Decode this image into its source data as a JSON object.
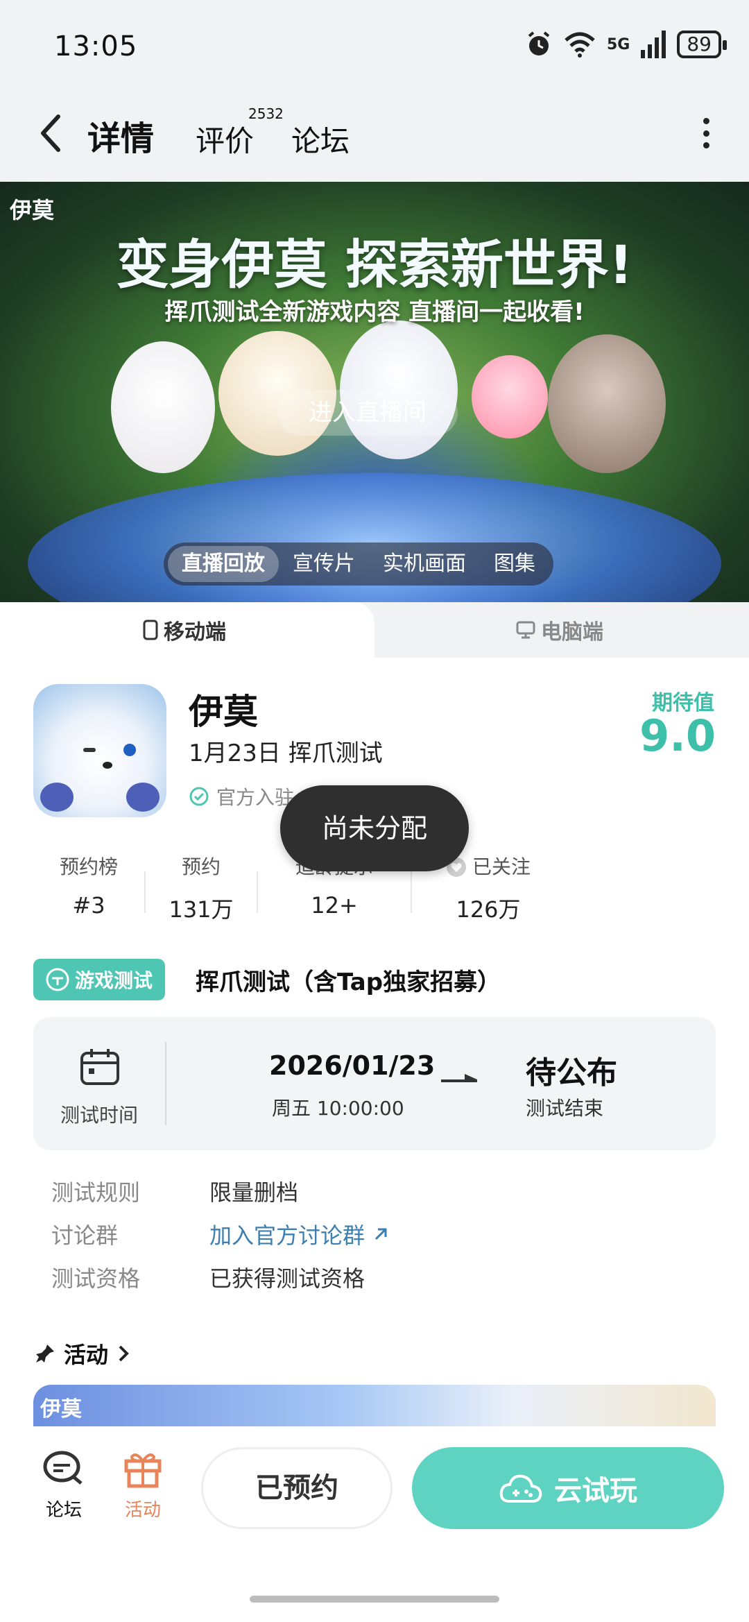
{
  "status_bar": {
    "time": "13:05",
    "battery": "89",
    "network": "5G"
  },
  "nav": {
    "tab_detail": "详情",
    "tab_review": "评价",
    "review_count": "2532",
    "tab_forum": "论坛"
  },
  "banner": {
    "logo": "伊莫",
    "title": "变身伊莫 探索新世界!",
    "subtitle": "挥爪测试全新游戏内容 直播间一起收看!",
    "live_button": "进入直播间",
    "media_tabs": [
      "直播回放",
      "宣传片",
      "实机画面",
      "图集"
    ]
  },
  "platform": {
    "mobile": "移动端",
    "pc": "电脑端"
  },
  "game": {
    "name": "伊莫",
    "date_info": "1月23日 挥爪测试",
    "official": "官方入驻",
    "expect_label": "期待值",
    "expect_value": "9.0"
  },
  "stats": [
    {
      "label": "预约榜",
      "value": "#3"
    },
    {
      "label": "预约",
      "value": "131万"
    },
    {
      "label": "适龄提示",
      "value": "12+"
    },
    {
      "label": "已关注",
      "value": "126万"
    }
  ],
  "toast": "尚未分配",
  "test": {
    "badge": "游戏测试",
    "title": "挥爪测试（含Tap独家招募）",
    "time_label": "测试时间",
    "start_date": "2026/01/23",
    "start_time": "周五 10:00:00",
    "end_value": "待公布",
    "end_label": "测试结束"
  },
  "info": {
    "rules_key": "测试规则",
    "rules_val": "限量删档",
    "group_key": "讨论群",
    "group_val": "加入官方讨论群",
    "qual_key": "测试资格",
    "qual_val": "已获得测试资格"
  },
  "activity": {
    "label": "活动",
    "banner_logo": "伊莫"
  },
  "bottom": {
    "forum": "论坛",
    "activity": "活动",
    "reserved": "已预约",
    "cloud_play": "云试玩"
  },
  "colors": {
    "accent": "#5fd3c1",
    "activity_orange": "#e8845a",
    "link": "#3d7fb0"
  }
}
